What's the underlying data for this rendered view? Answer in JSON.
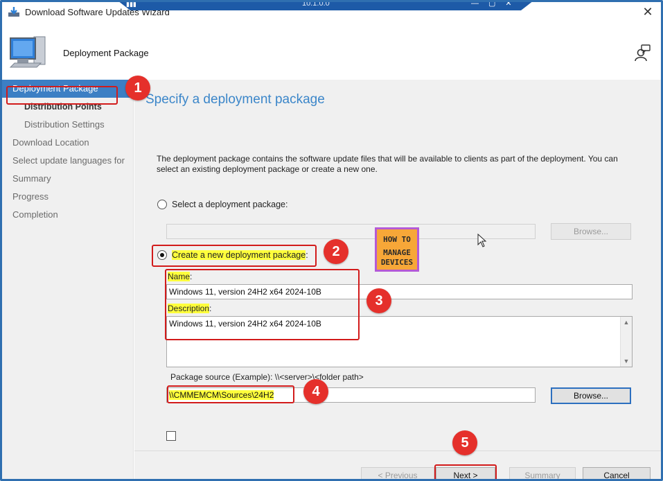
{
  "window": {
    "title": "Download Software Updates Wizard",
    "rdp_address": "10.1.0.0",
    "close_glyph": "✕"
  },
  "header": {
    "title": "Deployment Package"
  },
  "sidebar": {
    "items": [
      {
        "label": "Deployment Package",
        "state": "active"
      },
      {
        "label": "Distribution Points",
        "state": "sub-bold"
      },
      {
        "label": "Distribution Settings",
        "state": "sub"
      },
      {
        "label": "Download Location",
        "state": "normal"
      },
      {
        "label": "Select update languages for",
        "state": "normal"
      },
      {
        "label": "Summary",
        "state": "normal"
      },
      {
        "label": "Progress",
        "state": "normal"
      },
      {
        "label": "Completion",
        "state": "normal"
      }
    ]
  },
  "main": {
    "title": "Specify a deployment package",
    "description": "The deployment package contains the software update files that will be available to clients as part of the deployment. You can select an existing deployment package or create a new one.",
    "select_existing": {
      "label": "Select a deployment package:",
      "value": "",
      "browse_label": "Browse..."
    },
    "create_new": {
      "label": "Create a new deployment package",
      "label_suffix": ":",
      "name_label": "Name",
      "name_value": "Windows 11, version 24H2 x64 2024-10B",
      "description_label": "Description",
      "description_value": "Windows 11, version 24H2 x64 2024-10B",
      "source_label": "Package source (Example): \\\\<server>\\<folder path>",
      "source_value": "\\\\CMMEMCM\\Sources\\24H2",
      "browse_label": "Browse..."
    }
  },
  "footer": {
    "previous_label": "< Previous",
    "next_label": "Next >",
    "summary_label": "Summary",
    "cancel_label": "Cancel"
  },
  "watermark": {
    "line1": "HOW TO",
    "line2": "MANAGE",
    "line3": "DEVICES"
  },
  "annotations": {
    "steps": [
      "1",
      "2",
      "3",
      "4",
      "5"
    ],
    "color": "#e5302b"
  },
  "colors": {
    "accent": "#3c7fc4",
    "title_blue": "#3b86c9",
    "highlight": "#ffff3c"
  }
}
